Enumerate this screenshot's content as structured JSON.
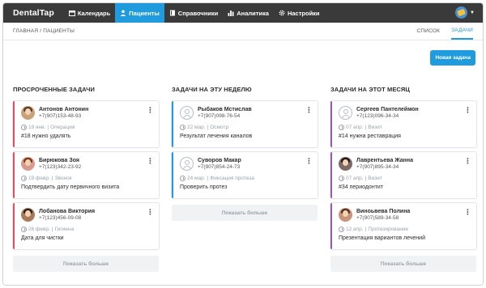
{
  "app": {
    "brand": "DentalTap"
  },
  "nav": {
    "items": [
      {
        "label": "Календарь",
        "icon": "calendar-icon",
        "active": false
      },
      {
        "label": "Пациенты",
        "icon": "user-icon",
        "active": true
      },
      {
        "label": "Справочники",
        "icon": "book-icon",
        "active": false
      },
      {
        "label": "Аналитика",
        "icon": "bar-chart-icon",
        "active": false
      },
      {
        "label": "Настройки",
        "icon": "gear-icon",
        "active": false
      }
    ]
  },
  "breadcrumb": "ГЛАВНАЯ / ПАЦИЕНТЫ",
  "view_tabs": [
    {
      "label": "СПИСОК",
      "active": false
    },
    {
      "label": "ЗАДАЧИ",
      "active": true
    }
  ],
  "new_task_label": "Новая задача",
  "show_more_label": "Показать больше",
  "columns": [
    {
      "title": "ПРОСРОЧЕННЫЕ ЗАДАЧИ",
      "accent": "#e84c5f",
      "cards": [
        {
          "name": "Антонов Антонин",
          "phone": "+7(907)153-48-93",
          "date": "19 янв.",
          "type": "Операция",
          "text": "#18 нужно удалять",
          "avatar": "photo"
        },
        {
          "name": "Бирюкова Зоя",
          "phone": "+7(123)342-23-92",
          "date": "19 февр.",
          "type": "Звонок",
          "text": "Подтвердить дату первичного визита",
          "avatar": "photo"
        },
        {
          "name": "Лобанова Виктория",
          "phone": "+7(123)456-09-08",
          "date": "26 февр.",
          "type": "Гигиена",
          "text": "Дата для чистки",
          "avatar": "photo"
        }
      ]
    },
    {
      "title": "ЗАДАЧИ НА ЭТУ НЕДЕЛЮ",
      "accent": "#1f9bde",
      "cards": [
        {
          "name": "Рыбаков Мстислав",
          "phone": "+7(907)098-76-54",
          "date": "22 мар.",
          "type": "Осмотр",
          "text": "Результат лечения каналов",
          "avatar": "placeholder"
        },
        {
          "name": "Суворов Макар",
          "phone": "+7(907)854-24-73",
          "date": "24 мар.",
          "type": "Фиксация протеза",
          "text": "Проверить протез",
          "avatar": "placeholder"
        }
      ]
    },
    {
      "title": "ЗАДАЧИ НА ЭТОТ МЕСЯЦ",
      "accent": "#9b59b6",
      "cards": [
        {
          "name": "Сергеев Пантелеймон",
          "phone": "+7(123)096-34-34",
          "date": "07 апр.",
          "type": "Визит",
          "text": "#14 нужна реставрация",
          "avatar": "placeholder"
        },
        {
          "name": "Лаврентьева Жанна",
          "phone": "+7(907)895-34-34",
          "date": "07 апр.",
          "type": "Визит",
          "text": "#34 периодонтит",
          "avatar": "photo"
        },
        {
          "name": "Виноьвева Полина",
          "phone": "+7(907)589-34-58",
          "date": "12 апр.",
          "type": "Протезирование",
          "text": "Презентация вариантов лечений",
          "avatar": "photo"
        }
      ]
    }
  ]
}
